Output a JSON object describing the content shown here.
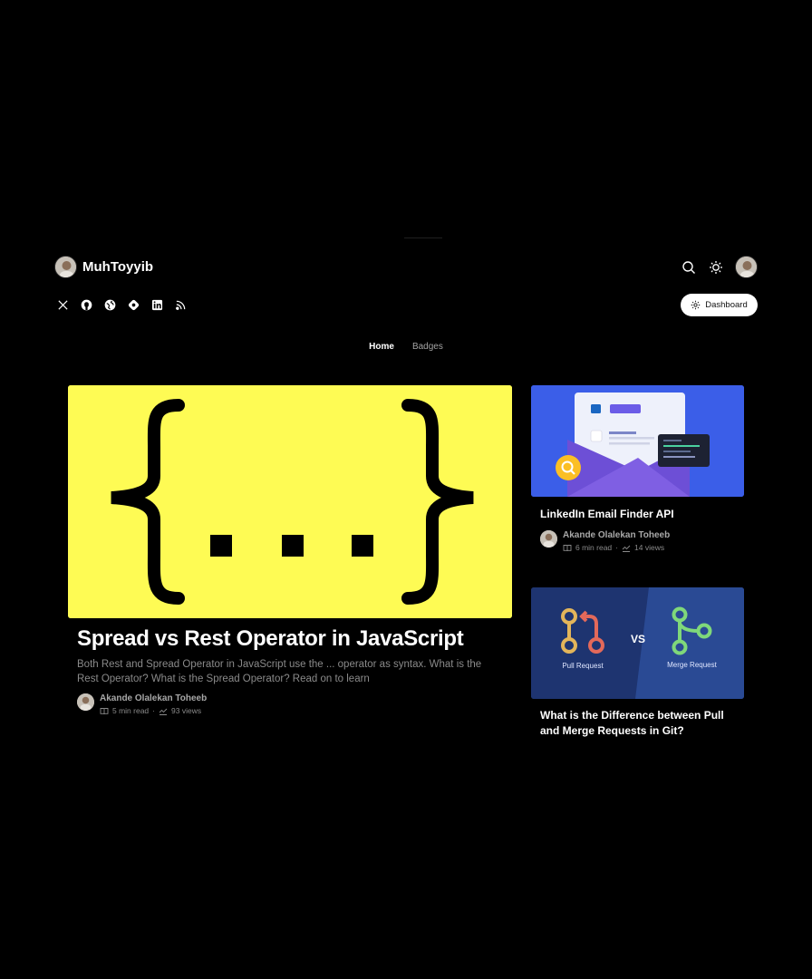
{
  "blog": {
    "name": "MuhToyyib",
    "dashboard_label": "Dashboard"
  },
  "header": {
    "icons": [
      "search-icon",
      "sun-icon",
      "avatar"
    ]
  },
  "social_icons": [
    "x-icon",
    "github-icon",
    "globe-icon",
    "hashnode-icon",
    "linkedin-icon",
    "rss-icon"
  ],
  "nav": {
    "tabs": [
      {
        "label": "Home",
        "active": true
      },
      {
        "label": "Badges",
        "active": false
      }
    ]
  },
  "featured": {
    "title": "Spread vs Rest Operator in JavaScript",
    "excerpt": "Both Rest and Spread Operator in JavaScript use the ... operator as syntax. What is the Rest Operator? What is the Spread Operator? Read on to learn",
    "author": "Akande Olalekan Toheeb",
    "read_time": "5 min read",
    "views": "93 views",
    "cover_text": "{...}"
  },
  "posts": [
    {
      "title": "LinkedIn Email Finder API",
      "author": "Akande Olalekan Toheeb",
      "read_time": "6 min read",
      "views": "14 views",
      "cover_color": "#3b5ee8"
    },
    {
      "title": "What is the Difference between Pull and Merge Requests in Git?",
      "cover_color": "#233d7c",
      "cover_labels": {
        "left": "Pull Request",
        "vs": "VS",
        "right": "Merge Request"
      }
    }
  ],
  "colors": {
    "background": "#000000",
    "featured_cover": "#fefb54"
  }
}
